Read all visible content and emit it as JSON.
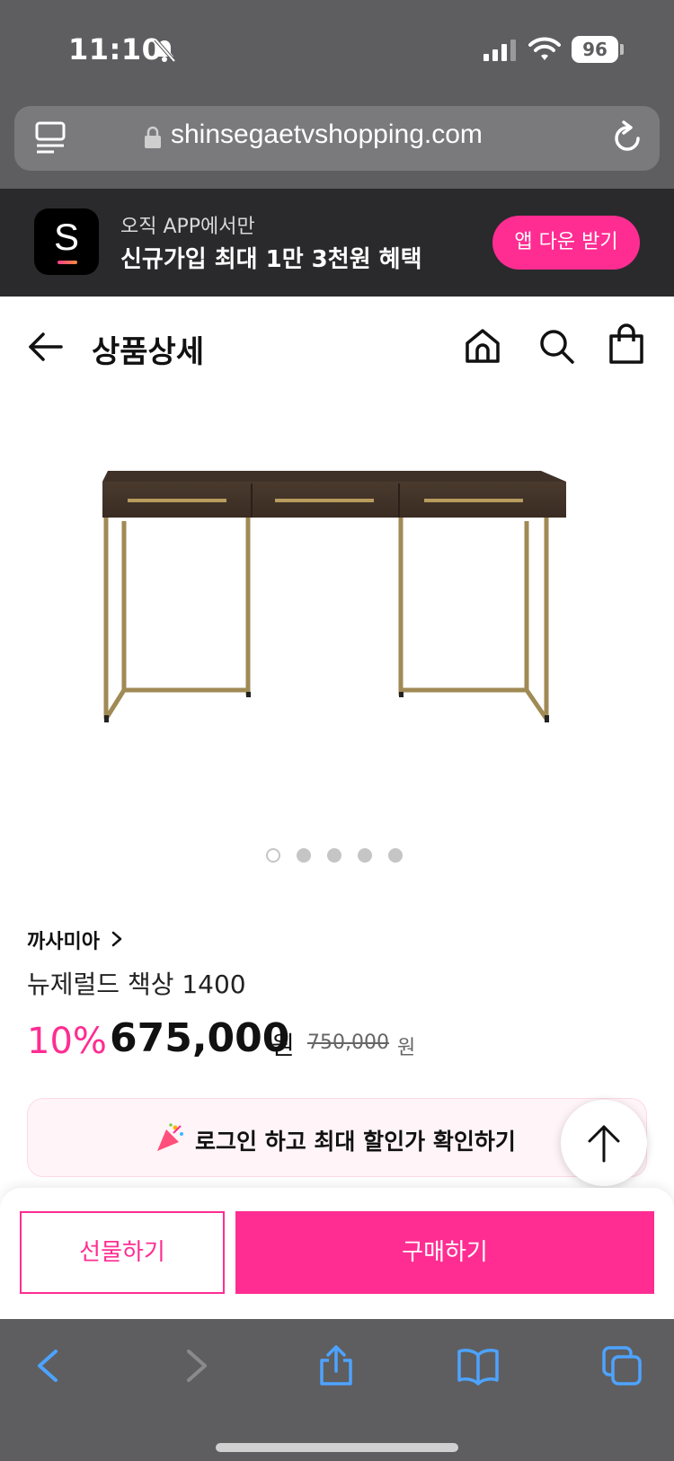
{
  "status": {
    "time": "11:10",
    "battery": "96"
  },
  "browser": {
    "url": "shinsegaetvshopping.com"
  },
  "app_banner": {
    "logo_letter": "S",
    "line1": "오직 APP에서만",
    "line2": "신규가입 최대 1만 3천원 혜택",
    "button": "앱 다운 받기"
  },
  "header": {
    "title": "상품상세"
  },
  "gallery": {
    "dots": 5,
    "active_index": 0
  },
  "product": {
    "brand": "까사미아",
    "name": "뉴제럴드 책상 1400",
    "discount": "10%",
    "price": "675,000",
    "price_unit": "원",
    "original_price": "750,000",
    "original_unit": "원"
  },
  "promo": {
    "text": "로그인 하고 최대 할인가 확인하기"
  },
  "actions": {
    "gift": "선물하기",
    "buy": "구매하기"
  },
  "colors": {
    "accent": "#ff2d92",
    "chrome": "#5e5e60",
    "banner_bg": "#2a2a2c"
  }
}
